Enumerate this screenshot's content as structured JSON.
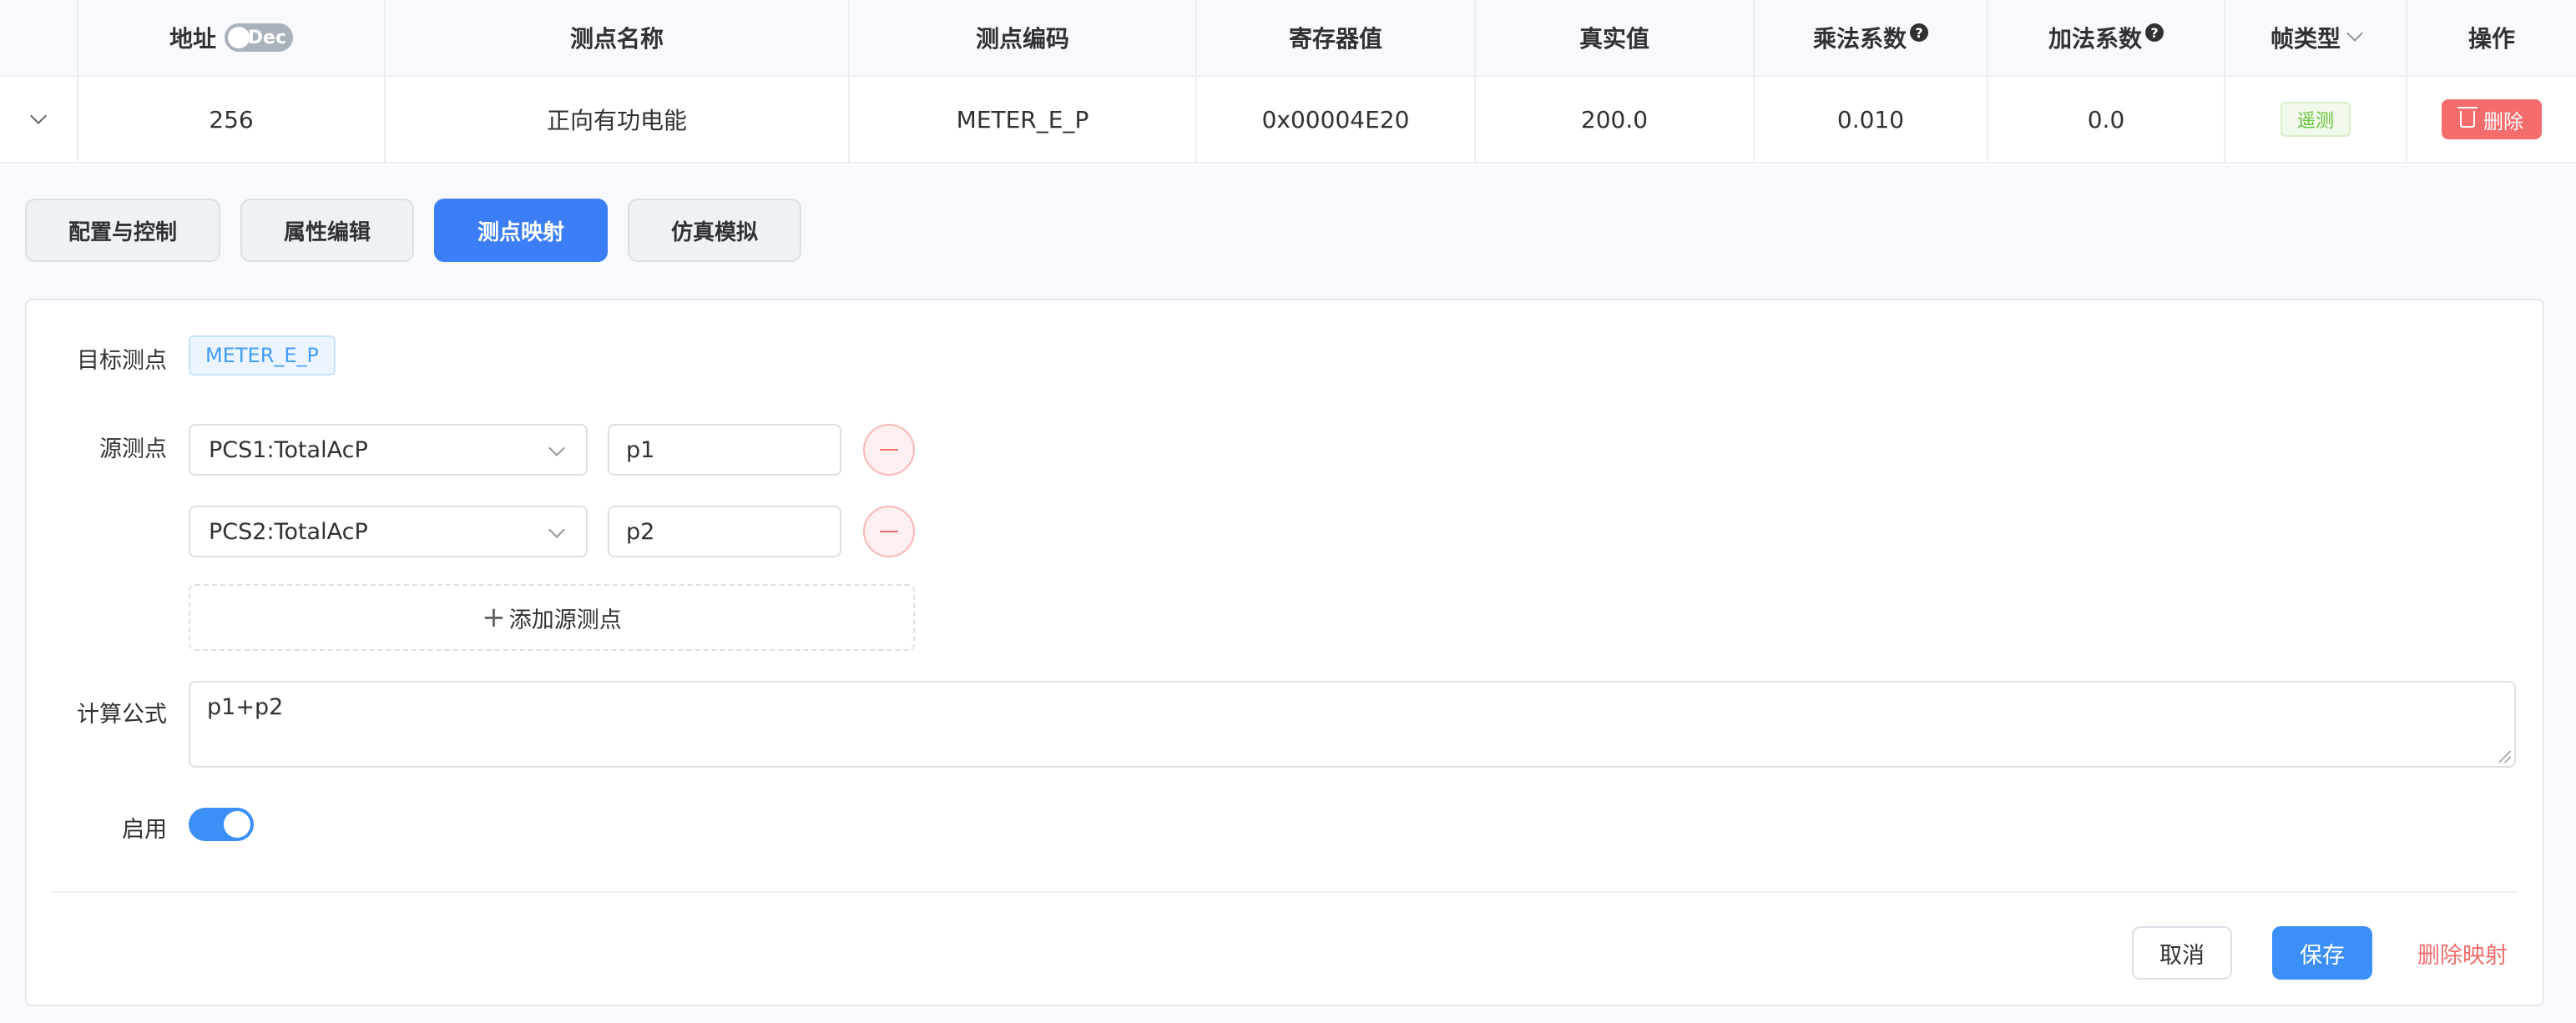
{
  "table": {
    "headers": {
      "address": "地址",
      "address_toggle": "Dec",
      "name": "测点名称",
      "code": "测点编码",
      "register": "寄存器值",
      "real": "真实值",
      "mult": "乘法系数",
      "add": "加法系数",
      "frame": "帧类型",
      "ops": "操作"
    },
    "row": {
      "address": "256",
      "name": "正向有功电能",
      "code": "METER_E_P",
      "register": "0x00004E20",
      "real": "200.0",
      "mult": "0.010",
      "add": "0.0",
      "frame_tag": "遥测",
      "delete_label": "删除"
    }
  },
  "tabs": [
    {
      "label": "配置与控制",
      "active": false
    },
    {
      "label": "属性编辑",
      "active": false
    },
    {
      "label": "测点映射",
      "active": true
    },
    {
      "label": "仿真模拟",
      "active": false
    }
  ],
  "mapping": {
    "target_label": "目标测点",
    "target_value": "METER_E_P",
    "source_label": "源测点",
    "sources": [
      {
        "point": "PCS1:TotalAcP",
        "alias": "p1"
      },
      {
        "point": "PCS2:TotalAcP",
        "alias": "p2"
      }
    ],
    "add_source_label": "添加源测点",
    "formula_label": "计算公式",
    "formula_value": "p1+p2",
    "enable_label": "启用",
    "enabled": true
  },
  "actions": {
    "cancel": "取消",
    "save": "保存",
    "delete_mapping": "删除映射"
  },
  "colors": {
    "primary": "#3b7ef7",
    "danger": "#f56c6c",
    "success": "#67c23a"
  }
}
